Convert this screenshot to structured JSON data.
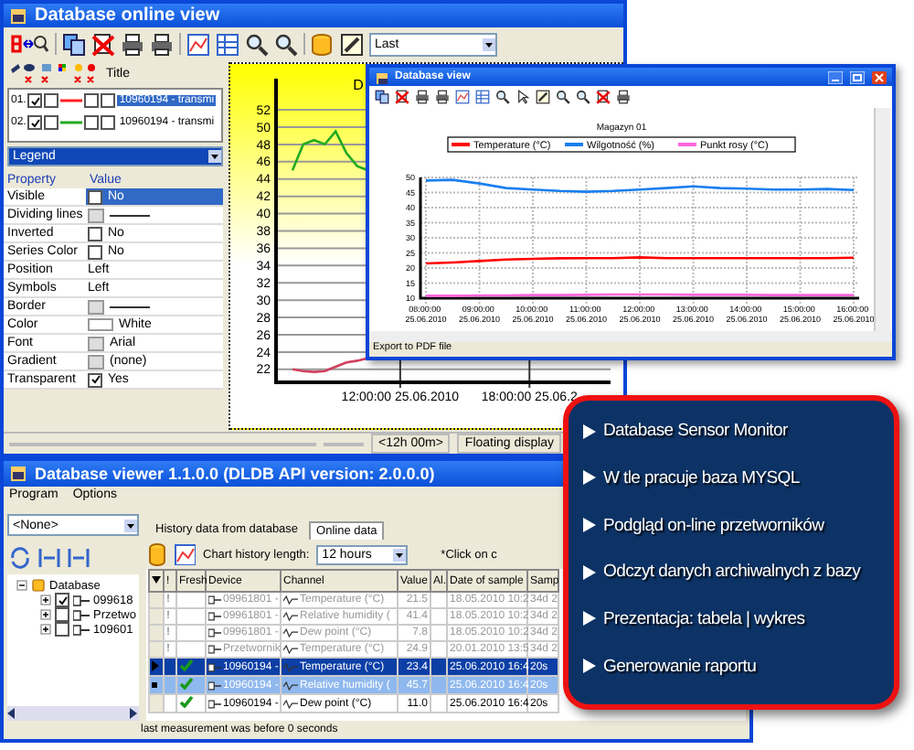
{
  "online_view": {
    "title": "Database online view",
    "period_combo": "Last",
    "series_header": "Title",
    "series": [
      {
        "number": "01.",
        "flags": [
          true,
          false,
          false,
          false
        ],
        "color": "#ff2020",
        "title": "10960194 - transmi",
        "selected": true
      },
      {
        "number": "02.",
        "flags": [
          true,
          false,
          false,
          false
        ],
        "color": "#22aa22",
        "title": "10960194 - transmi",
        "selected": false
      }
    ],
    "object_combo": "Legend",
    "property_columns": [
      "Property",
      "Value"
    ],
    "properties": [
      {
        "name": "Visible",
        "kind": "check",
        "checked": false,
        "value": "No",
        "selected": true
      },
      {
        "name": "Dividing lines",
        "kind": "line",
        "selected": false
      },
      {
        "name": "Inverted",
        "kind": "check",
        "checked": false,
        "value": "No",
        "selected": false
      },
      {
        "name": "Series Color",
        "kind": "check",
        "checked": false,
        "value": "No",
        "selected": false
      },
      {
        "name": "Position",
        "kind": "text",
        "value": "Left",
        "selected": false
      },
      {
        "name": "Symbols",
        "kind": "text",
        "value": "Left",
        "selected": false
      },
      {
        "name": "Border",
        "kind": "line",
        "selected": false
      },
      {
        "name": "Color",
        "kind": "color",
        "value": "White",
        "selected": false
      },
      {
        "name": "Font",
        "kind": "button",
        "value": "Arial",
        "selected": false
      },
      {
        "name": "Gradient",
        "kind": "button",
        "value": "(none)",
        "selected": false
      },
      {
        "name": "Transparent",
        "kind": "check",
        "checked": true,
        "value": "Yes",
        "selected": false
      }
    ],
    "chart_data": {
      "type": "line",
      "title": "D",
      "grid": true,
      "categories": [
        null,
        null,
        null,
        null,
        null,
        null,
        null,
        null,
        null,
        null,
        "12:00:00 25.06.2010",
        null,
        null,
        null,
        null,
        null,
        null,
        null,
        null,
        null,
        null,
        null,
        "18:00:00 25.06.2",
        null,
        null,
        null,
        null,
        null,
        null
      ],
      "series": [
        {
          "color": "#22aa22",
          "values": [
            45,
            48,
            48.5,
            48,
            49.5,
            47,
            45.5,
            45,
            null,
            null,
            null,
            null,
            null,
            null,
            null,
            null,
            null,
            null,
            null,
            null,
            null,
            null,
            null,
            null,
            null,
            null,
            null,
            null,
            null
          ]
        },
        {
          "color": "#d04060",
          "values": [
            22,
            21.8,
            21.7,
            21.8,
            22.3,
            22.8,
            23,
            23.3,
            null,
            null,
            null,
            null,
            null,
            null,
            null,
            null,
            null,
            null,
            null,
            null,
            null,
            null,
            null,
            null,
            null,
            null,
            null,
            null,
            null
          ]
        }
      ],
      "ylim": [
        20.5,
        55.6
      ],
      "yticks": [
        22,
        24,
        26,
        28,
        30,
        32,
        34,
        36,
        38,
        40,
        42,
        44,
        46,
        48,
        50,
        52
      ]
    },
    "status": [
      "<12h 00m>",
      "Floating display"
    ]
  },
  "database_view": {
    "title": "Database view",
    "chart_data": {
      "type": "line",
      "title": "Magazyn 01",
      "grid": true,
      "legend": "top",
      "categories": [
        "08:00:00 25.06.2010",
        null,
        "09:00:00 25.06.2010",
        null,
        "10:00:00 25.06.2010",
        null,
        "11:00:00 25.06.2010",
        null,
        "12:00:00 25.06.2010",
        null,
        "13:00:00 25.06.2010",
        null,
        "14:00:00 25.06.2010",
        null,
        "15:00:00 25.06.2010",
        null,
        "16:00:00 25.06.2010"
      ],
      "series": [
        {
          "name": "Temperature (°C)",
          "color": "#ff0000",
          "values": [
            21.5,
            21.8,
            22.3,
            22.8,
            23,
            23.2,
            23.3,
            23.3,
            23.5,
            23.3,
            23.3,
            23.3,
            23.3,
            23.3,
            23.3,
            23.3,
            23.4
          ]
        },
        {
          "name": "Wilgotność (%)",
          "color": "#1a7ff0",
          "values": [
            49,
            49.2,
            48,
            46.5,
            46,
            45.5,
            45.3,
            45.5,
            46,
            46.5,
            47,
            46.5,
            46.3,
            46,
            46,
            46.2,
            45.8
          ]
        },
        {
          "name": "Punkt rosy (°C)",
          "color": "#ff66dd",
          "values": [
            10.8,
            10.8,
            10.9,
            10.9,
            11,
            11,
            11.1,
            11.2,
            11.2,
            11.2,
            11.1,
            11.1,
            11.1,
            11,
            11,
            11,
            11
          ]
        }
      ],
      "ylim": [
        10,
        50
      ],
      "yticks": [
        10,
        15,
        20,
        25,
        30,
        35,
        40,
        45,
        50
      ]
    },
    "status": "Export to PDF file"
  },
  "viewer": {
    "title": "Database viewer  1.1.0.0  (DLDB API version: 2.0.0.0)",
    "menu": [
      "Program",
      "Options"
    ],
    "source_combo": "<None>",
    "tree": [
      {
        "label": "Database",
        "expanded": true,
        "children": [
          {
            "label": "099618",
            "checked": true,
            "expanded": false
          },
          {
            "label": "Przetwo",
            "checked": false,
            "expanded": false
          },
          {
            "label": "109601",
            "checked": false,
            "expanded": false
          }
        ]
      }
    ],
    "tabs": [
      {
        "label": "History data from database",
        "selected": false
      },
      {
        "label": "Online data",
        "selected": true
      }
    ],
    "history_label": "Chart history length:",
    "history_combo": "12 hours",
    "hint": "*Click on c",
    "columns": [
      "!",
      "Fresh",
      "Device",
      "Channel",
      "Value",
      "Al.",
      "Date of sample",
      "Samp"
    ],
    "rows": [
      {
        "alert": "!",
        "fresh": false,
        "stale": true,
        "device": "09961801 -",
        "channel": "Temperature (°C)",
        "value": "21.5",
        "date": "18.05.2010 10:2",
        "samp": "34d 2",
        "selected": false,
        "current": false
      },
      {
        "alert": "!",
        "fresh": false,
        "stale": true,
        "device": "09961801 -",
        "channel": "Relative humidity (",
        "value": "41.4",
        "date": "18.05.2010 10:2",
        "samp": "34d 2",
        "selected": false,
        "current": false
      },
      {
        "alert": "!",
        "fresh": false,
        "stale": true,
        "device": "09961801 -",
        "channel": "Dew point (°C)",
        "value": "7.8",
        "date": "18.05.2010 10:2",
        "samp": "34d 2",
        "selected": false,
        "current": false
      },
      {
        "alert": "!",
        "fresh": false,
        "stale": true,
        "device": "Przetwornik",
        "channel": "Temperature (°C)",
        "value": "24.9",
        "date": "20.01.2010 13:5",
        "samp": "34d 2",
        "selected": false,
        "current": false
      },
      {
        "fresh": true,
        "stale": false,
        "device": "10960194 -",
        "channel": "Temperature (°C)",
        "value": "23.4",
        "date": "25.06.2010 16:4",
        "samp": "20s",
        "selected": true,
        "current": true
      },
      {
        "fresh": true,
        "stale": false,
        "device": "10960194 -",
        "channel": "Relative humidity (",
        "value": "45.7",
        "date": "25.06.2010 16:4",
        "samp": "20s",
        "selected": true,
        "current": false
      },
      {
        "fresh": true,
        "stale": false,
        "device": "10960194 -",
        "channel": "Dew point (°C)",
        "value": "11.0",
        "date": "25.06.2010 16:4",
        "samp": "20s",
        "selected": false,
        "current": false
      }
    ],
    "status": "last measurement was before 0 seconds"
  },
  "features": [
    "Database Sensor Monitor",
    "W tle pracuje baza MYSQL",
    "Podgląd on-line przetworników",
    "Odczyt danych archiwalnych z bazy",
    "Prezentacja: tabela | wykres",
    "Generowanie raportu"
  ]
}
